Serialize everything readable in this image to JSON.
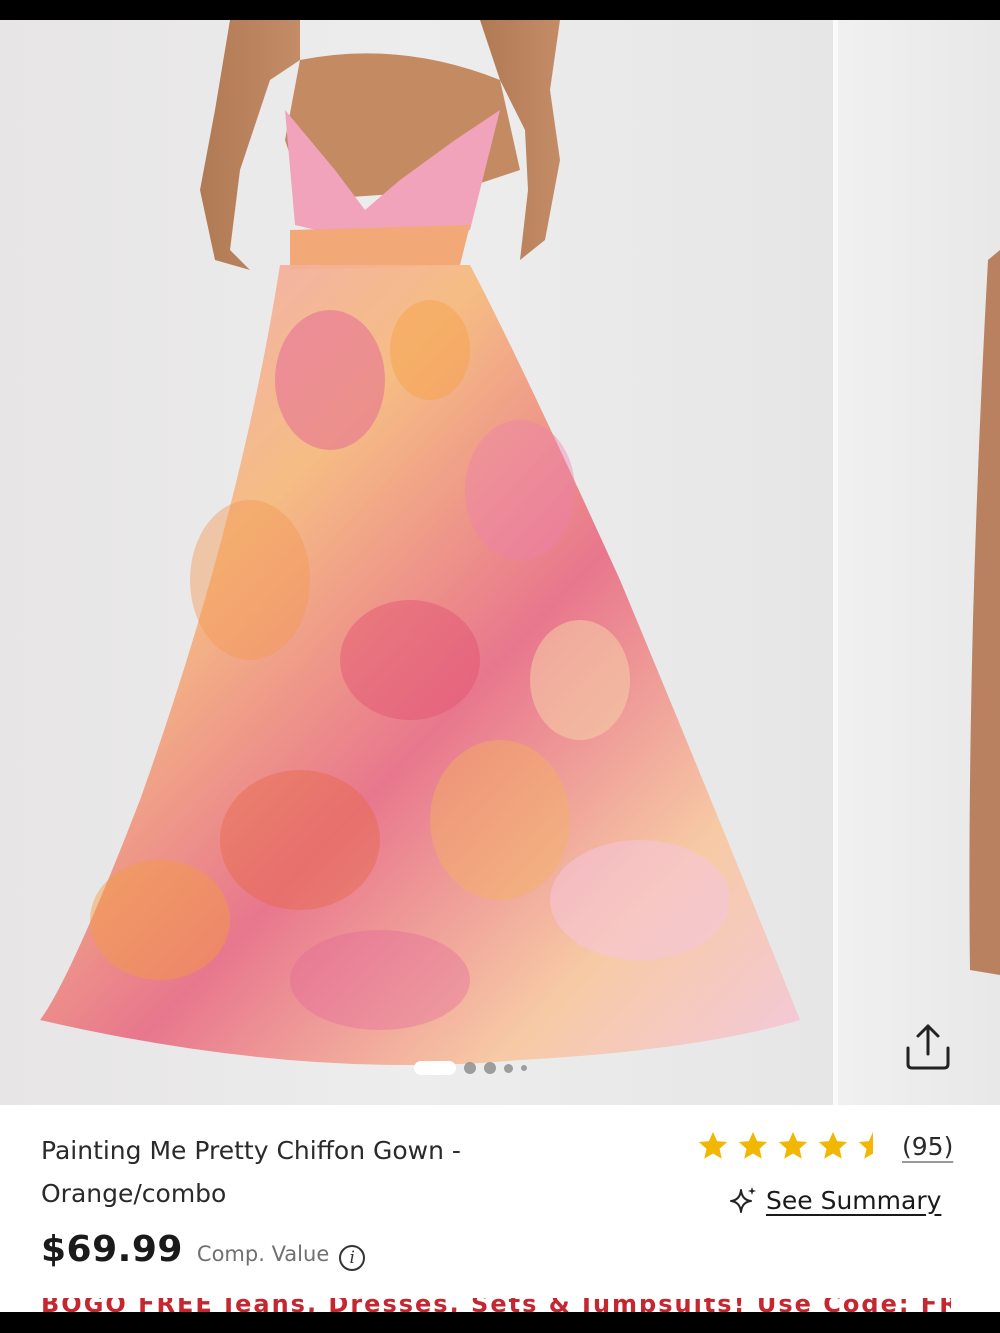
{
  "product": {
    "title": "Painting Me Pretty Chiffon Gown - Orange/combo",
    "price": "$69.99",
    "comp_value_label": "Comp. Value",
    "info_icon": "i",
    "rating": 4.5,
    "review_count": "(95)",
    "see_summary_label": "See Summary",
    "promo_banner": "BOGO FREE Jeans, Dresses, Sets & Jumpsuits! Use Code: FREE"
  },
  "carousel": {
    "image_alt": "Model wearing a pink and orange watercolor floral chiffon maxi gown",
    "dots_total": 6,
    "active_index": 0
  },
  "colors": {
    "star": "#f2b705",
    "promo": "#c4272f"
  },
  "icons": {
    "share": "share-icon",
    "sparkle": "sparkle-icon",
    "info": "info-icon",
    "star": "star-icon"
  }
}
